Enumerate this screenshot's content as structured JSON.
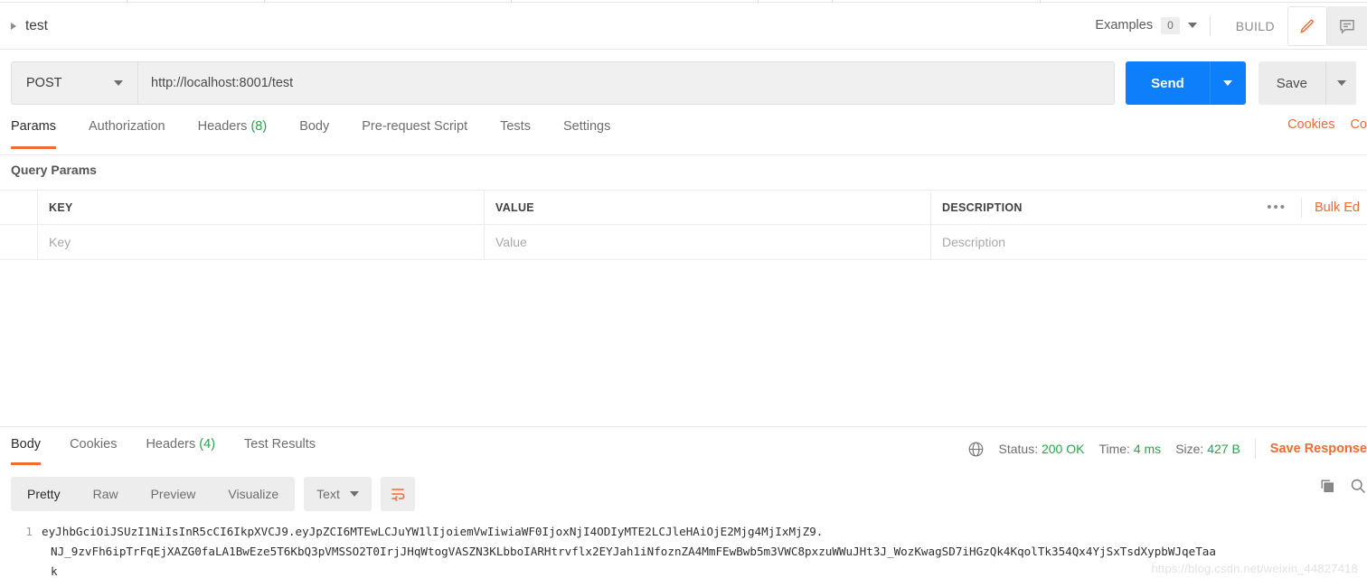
{
  "header": {
    "breadcrumb_name": "test",
    "examples_label": "Examples",
    "examples_count": "0",
    "build_label": "BUILD",
    "edit_icon": "pencil-icon",
    "comment_icon": "comment-icon"
  },
  "request": {
    "method": "POST",
    "url": "http://localhost:8001/test",
    "send_label": "Send",
    "save_label": "Save",
    "tabs": [
      {
        "label": "Params",
        "count": "",
        "active": true
      },
      {
        "label": "Authorization",
        "count": "",
        "active": false
      },
      {
        "label": "Headers",
        "count": "(8)",
        "active": false
      },
      {
        "label": "Body",
        "count": "",
        "active": false
      },
      {
        "label": "Pre-request Script",
        "count": "",
        "active": false
      },
      {
        "label": "Tests",
        "count": "",
        "active": false
      },
      {
        "label": "Settings",
        "count": "",
        "active": false
      }
    ],
    "cookies_link": "Cookies",
    "code_link": "Co"
  },
  "params": {
    "section_title": "Query Params",
    "columns": [
      "KEY",
      "VALUE",
      "DESCRIPTION"
    ],
    "more_menu": "•••",
    "bulk_edit_label": "Bulk Ed",
    "rows": [
      {
        "key": "Key",
        "value": "Value",
        "description": "Description"
      }
    ]
  },
  "response": {
    "tabs": [
      {
        "label": "Body",
        "count": "",
        "active": true
      },
      {
        "label": "Cookies",
        "count": "",
        "active": false
      },
      {
        "label": "Headers",
        "count": "(4)",
        "active": false
      },
      {
        "label": "Test Results",
        "count": "",
        "active": false
      }
    ],
    "status_label": "Status:",
    "status_value": "200 OK",
    "time_label": "Time:",
    "time_value": "4 ms",
    "size_label": "Size:",
    "size_value": "427 B",
    "save_response_label": "Save Response",
    "viewer_modes": [
      {
        "label": "Pretty",
        "active": true
      },
      {
        "label": "Raw",
        "active": false
      },
      {
        "label": "Preview",
        "active": false
      },
      {
        "label": "Visualize",
        "active": false
      }
    ],
    "format": "Text",
    "wrap_icon": "word-wrap-icon",
    "copy_icon": "copy-icon",
    "search_icon": "search-icon",
    "body_lines": [
      {
        "number": "1",
        "segments": [
          "eyJhbGciOiJSUzI1NiIsInR5cCI6IkpXVCJ9.eyJpZCI6MTEwLCJuYW1lIjoiemVwIiwiaWF0IjoxNjI4ODIyMTE2LCJleHAiOjE2Mjg4MjIxMjZ9.",
          "NJ_9zvFh6ipTrFqEjXAZG0faLA1BwEze5T6KbQ3pVMSSO2T0IrjJHqWtogVASZN3KLbboIARHtrvflx2EYJah1iNfoznZA4MmFEwBwb5m3VWC8pxzuWWuJHt3J_WozKwagSD7iHGzQk4KqolTk354Qx4YjSxTsdXypbWJqeTaa",
          "k"
        ]
      }
    ]
  },
  "watermark": "https://blog.csdn.net/weixin_44827418"
}
